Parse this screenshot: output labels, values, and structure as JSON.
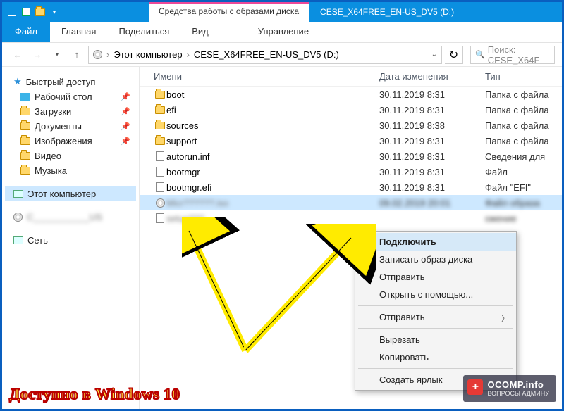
{
  "titlebar": {
    "context_tab": "Средства работы с образами диска",
    "title": "CESE_X64FREE_EN-US_DV5 (D:)"
  },
  "ribbon": {
    "file": "Файл",
    "home": "Главная",
    "share": "Поделиться",
    "view": "Вид",
    "manage": "Управление"
  },
  "nav": {
    "pc": "Этот компьютер",
    "loc": "CESE_X64FREE_EN-US_DV5 (D:)",
    "search_ph": "Поиск: CESE_X64F"
  },
  "sidebar": {
    "quick": "Быстрый доступ",
    "desktop": "Рабочий стол",
    "downloads": "Загрузки",
    "documents": "Документы",
    "pictures": "Изображения",
    "video": "Видео",
    "music": "Музыка",
    "thispc": "Этот компьютер",
    "drive_obscured": "C___________US",
    "network": "Сеть"
  },
  "columns": {
    "name": "Имени",
    "date": "Дата изменения",
    "type": "Тип"
  },
  "rows": [
    {
      "icon": "folder",
      "name": "boot",
      "date": "30.11.2019 8:31",
      "type": "Папка с файла"
    },
    {
      "icon": "folder",
      "name": "efi",
      "date": "30.11.2019 8:31",
      "type": "Папка с файла"
    },
    {
      "icon": "folder",
      "name": "sources",
      "date": "30.11.2019 8:38",
      "type": "Папка с файла"
    },
    {
      "icon": "folder",
      "name": "support",
      "date": "30.11.2019 8:31",
      "type": "Папка с файла"
    },
    {
      "icon": "file",
      "name": "autorun.inf",
      "date": "30.11.2019 8:31",
      "type": "Сведения для"
    },
    {
      "icon": "file",
      "name": "bootmgr",
      "date": "30.11.2019 8:31",
      "type": "Файл"
    },
    {
      "icon": "file",
      "name": "bootmgr.efi",
      "date": "30.11.2019 8:31",
      "type": "Файл \"EFI\""
    },
    {
      "icon": "disc",
      "name": "Micr??????.iso",
      "date": "09.02.2019 20:01",
      "type": "Файл образа",
      "sel": true,
      "blur": true
    },
    {
      "icon": "file",
      "name": "setup???",
      "date": "",
      "type": "ожение",
      "blur": true
    }
  ],
  "ctx": {
    "mount": "Подключить",
    "burn": "Записать образ диска",
    "send": "Отправить",
    "openwith": "Открыть с помощью...",
    "sendto": "Отправить",
    "cut": "Вырезать",
    "copy": "Копировать",
    "shortcut": "Создать ярлык"
  },
  "caption": "Доступно в Windows 10",
  "watermark": {
    "big": "OCOMP.info",
    "small": "ВОПРОСЫ АДМИНУ"
  }
}
